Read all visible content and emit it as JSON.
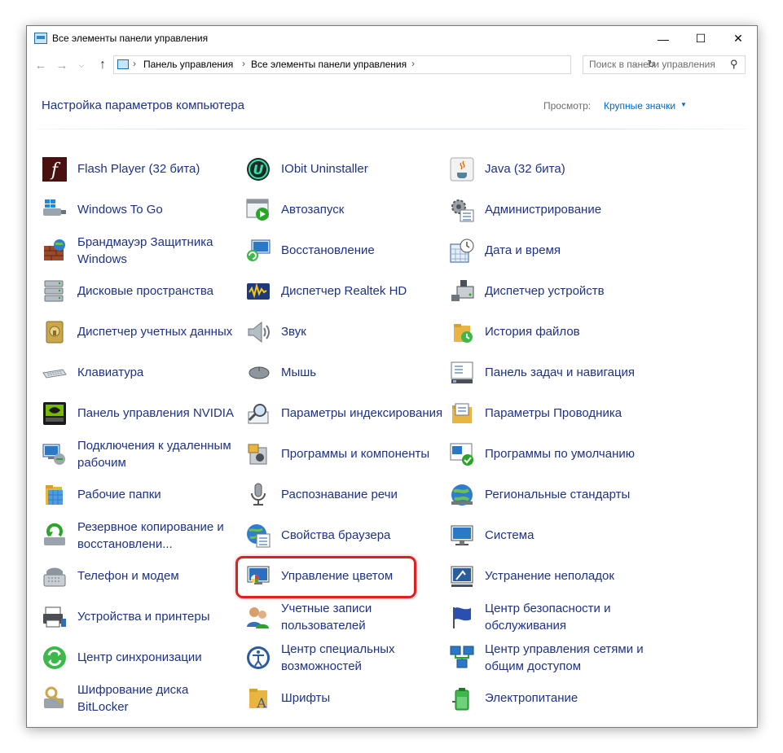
{
  "window": {
    "title": "Все элементы панели управления",
    "controls": {
      "minimize": "—",
      "maximize": "☐",
      "close": "✕"
    }
  },
  "address_bar": {
    "breadcrumb": [
      "Панель управления",
      "Все элементы панели управления"
    ],
    "separator": "›",
    "dropdown": "⌵",
    "refresh": "↻"
  },
  "nav": {
    "back": "←",
    "forward": "→",
    "recent": "⌵",
    "up": "↑"
  },
  "search": {
    "placeholder": "Поиск в панели управления",
    "icon": "⚲"
  },
  "header": {
    "title": "Настройка параметров компьютера",
    "view_label": "Просмотр:",
    "view_value": "Крупные значки",
    "view_arrow": "▼"
  },
  "columns": [
    [
      {
        "label": "Flash Player (32 бита)",
        "icon": "flash-icon"
      },
      {
        "label": "Windows To Go",
        "icon": "windows-to-go-icon"
      },
      {
        "label": "Брандмауэр Защитника Windows",
        "icon": "firewall-icon"
      },
      {
        "label": "Дисковые пространства",
        "icon": "storage-spaces-icon"
      },
      {
        "label": "Диспетчер учетных данных",
        "icon": "credential-manager-icon"
      },
      {
        "label": "Клавиатура",
        "icon": "keyboard-icon"
      },
      {
        "label": "Панель управления NVIDIA",
        "icon": "nvidia-icon"
      },
      {
        "label": "Подключения к удаленным рабочим",
        "icon": "remote-desktop-icon"
      },
      {
        "label": "Рабочие папки",
        "icon": "work-folders-icon"
      },
      {
        "label": "Резервное копирование и восстановлени...",
        "icon": "backup-icon"
      },
      {
        "label": "Телефон и модем",
        "icon": "phone-modem-icon"
      },
      {
        "label": "Устройства и принтеры",
        "icon": "printer-icon"
      },
      {
        "label": "Центр синхронизации",
        "icon": "sync-icon"
      },
      {
        "label": "Шифрование диска BitLocker",
        "icon": "bitlocker-icon"
      }
    ],
    [
      {
        "label": "IObit Uninstaller",
        "icon": "iobit-icon"
      },
      {
        "label": "Автозапуск",
        "icon": "autoplay-icon"
      },
      {
        "label": "Восстановление",
        "icon": "recovery-icon"
      },
      {
        "label": "Диспетчер Realtek HD",
        "icon": "realtek-icon"
      },
      {
        "label": "Звук",
        "icon": "sound-icon"
      },
      {
        "label": "Мышь",
        "icon": "mouse-icon"
      },
      {
        "label": "Параметры индексирования",
        "icon": "indexing-icon"
      },
      {
        "label": "Программы и компоненты",
        "icon": "programs-icon"
      },
      {
        "label": "Распознавание речи",
        "icon": "microphone-icon"
      },
      {
        "label": "Свойства браузера",
        "icon": "internet-options-icon"
      },
      {
        "label": "Управление цветом",
        "icon": "color-management-icon"
      },
      {
        "label": "Учетные записи пользователей",
        "icon": "user-accounts-icon"
      },
      {
        "label": "Центр специальных возможностей",
        "icon": "accessibility-icon"
      },
      {
        "label": "Шрифты",
        "icon": "fonts-icon"
      }
    ],
    [
      {
        "label": "Java (32 бита)",
        "icon": "java-icon"
      },
      {
        "label": "Администрирование",
        "icon": "admin-tools-icon"
      },
      {
        "label": "Дата и время",
        "icon": "clock-icon"
      },
      {
        "label": "Диспетчер устройств",
        "icon": "device-manager-icon"
      },
      {
        "label": "История файлов",
        "icon": "file-history-icon"
      },
      {
        "label": "Панель задач и навигация",
        "icon": "taskbar-icon"
      },
      {
        "label": "Параметры Проводника",
        "icon": "explorer-options-icon"
      },
      {
        "label": "Программы по умолчанию",
        "icon": "default-programs-icon"
      },
      {
        "label": "Региональные стандарты",
        "icon": "region-icon"
      },
      {
        "label": "Система",
        "icon": "system-icon"
      },
      {
        "label": "Устранение неполадок",
        "icon": "troubleshooting-icon"
      },
      {
        "label": "Центр безопасности и обслуживания",
        "icon": "security-flag-icon"
      },
      {
        "label": "Центр управления сетями и общим доступом",
        "icon": "network-icon"
      },
      {
        "label": "Электропитание",
        "icon": "power-icon"
      }
    ]
  ],
  "highlighted_item": "Управление цветом",
  "colors": {
    "link": "#1e3287",
    "accent": "#0066cc",
    "highlight": "#e02020"
  }
}
